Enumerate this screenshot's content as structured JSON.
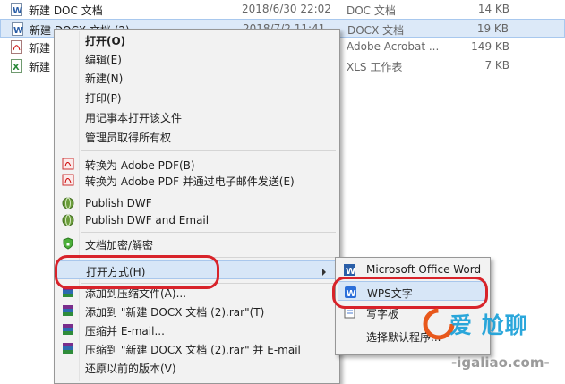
{
  "files": [
    {
      "name": "新建 DOC 文档",
      "date": "2018/6/30 22:02",
      "type": "DOC 文档",
      "size": "14 KB"
    },
    {
      "name": "新建 DOCX 文档 (2)",
      "date": "2018/7/2 11:41",
      "type": "DOCX 文档",
      "size": "19 KB"
    },
    {
      "name": "新建",
      "date": "",
      "type": "Adobe Acrobat ...",
      "size": "149 KB"
    },
    {
      "name": "新建",
      "date": "",
      "type": "XLS 工作表",
      "size": "7 KB"
    }
  ],
  "menu": {
    "open": "打开(O)",
    "edit": "编辑(E)",
    "new": "新建(N)",
    "print": "打印(P)",
    "notepad": "用记事本打开该文件",
    "admin": "管理员取得所有权",
    "to_pdf": "转换为 Adobe PDF(B)",
    "pdf_mail": "转换为 Adobe PDF 并通过电子邮件发送(E)",
    "dwf": "Publish DWF",
    "dwf_mail": "Publish DWF and Email",
    "encrypt": "文档加密/解密",
    "open_with": "打开方式(H)",
    "add_archive": "添加到压缩文件(A)...",
    "add_rar": "添加到 \"新建 DOCX 文档 (2).rar\"(T)",
    "compress_email": "压缩并 E-mail...",
    "compress_rar_email": "压缩到 \"新建 DOCX 文档 (2).rar\" 并 E-mail",
    "restore": "还原以前的版本(V)"
  },
  "submenu": {
    "word": "Microsoft Office Word",
    "wps": "WPS文字",
    "wordpad": "写字板",
    "choose": "选择默认程序..."
  },
  "watermark": {
    "logo": "爱  尬聊",
    "url": "-igaliao.com-"
  },
  "colors": {
    "annotation": "#d8232a",
    "highlight": "#d7e6f7",
    "wps": "#2b6ed9"
  }
}
